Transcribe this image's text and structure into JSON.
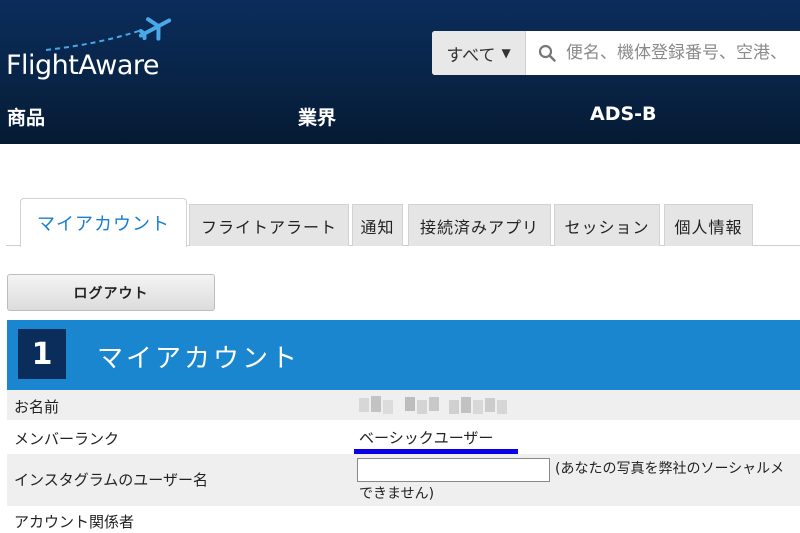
{
  "header": {
    "logo_text": "FlightAware",
    "search": {
      "scope_label": "すべて",
      "placeholder": "便名、機体登録番号、空港、"
    },
    "nav": [
      "商品",
      "業界",
      "ADS-B"
    ]
  },
  "tabs": [
    "マイアカウント",
    "フライトアラート",
    "通知",
    "接続済みアプリ",
    "セッション",
    "個人情報"
  ],
  "logout_label": "ログアウト",
  "section": {
    "number": "1",
    "title": "マイアカウント"
  },
  "account": {
    "name_label": "お名前",
    "rank_label": "メンバーランク",
    "rank_value": "ベーシックユーザー",
    "instagram_label": "インスタグラムのユーザー名",
    "instagram_note_line1": "(あなたの写真を弊社のソーシャルメ",
    "instagram_note_line2": "できません)",
    "related_label": "アカウント関係者"
  },
  "colors": {
    "header_bg": "#0b2d5c",
    "accent": "#1a86d0",
    "active_tab_text": "#1a7fd0",
    "annotation_underline": "#0a00e8"
  },
  "icons": [
    "plane-icon",
    "search-icon",
    "caret-down-icon"
  ]
}
